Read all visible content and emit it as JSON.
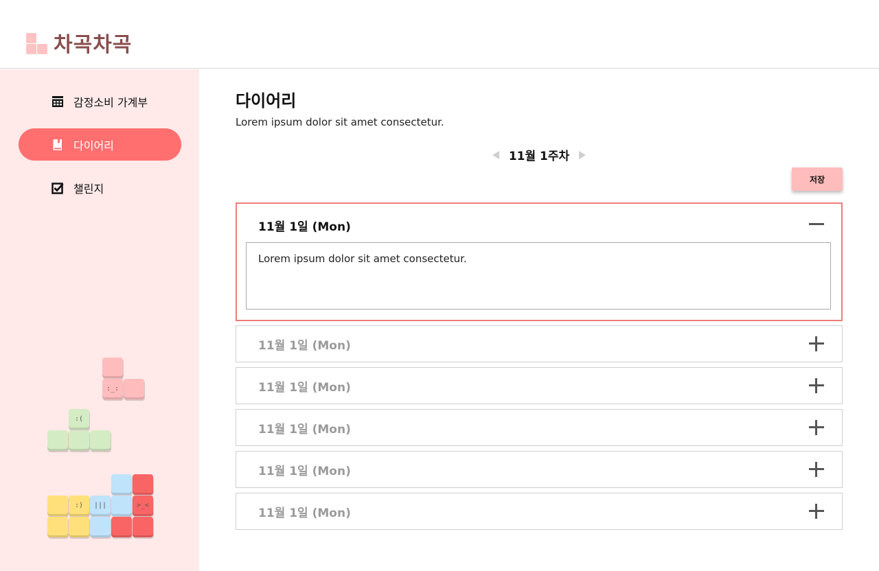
{
  "app": {
    "logo_text": "차곡차곡"
  },
  "sidebar": {
    "items": [
      {
        "label": "감정소비 가계부",
        "icon": "calendar-icon",
        "active": false
      },
      {
        "label": "다이어리",
        "icon": "book-icon",
        "active": true
      },
      {
        "label": "챌린지",
        "icon": "checkbox-icon",
        "active": false
      }
    ]
  },
  "main": {
    "title": "다이어리",
    "description": "Lorem ipsum dolor sit amet consectetur.",
    "week_label": "11월 1주차",
    "save_label": "저장",
    "entries": [
      {
        "date": "11월 1일 (Mon)",
        "expanded": true,
        "text": "Lorem ipsum dolor sit amet consectetur."
      },
      {
        "date": "11월 1일 (Mon)",
        "expanded": false
      },
      {
        "date": "11월 1일 (Mon)",
        "expanded": false
      },
      {
        "date": "11월 1일 (Mon)",
        "expanded": false
      },
      {
        "date": "11월 1일 (Mon)",
        "expanded": false
      },
      {
        "date": "11월 1일 (Mon)",
        "expanded": false
      }
    ]
  },
  "colors": {
    "accent": "#ff6f6f",
    "sidebar_bg": "#ffe9e9",
    "logo": "#8a4d4d",
    "block_pink": "#ffbcbc",
    "block_green": "#d4ecc4",
    "block_yellow": "#ffe07a",
    "block_blue": "#bfe3fb",
    "block_red": "#f96565"
  }
}
